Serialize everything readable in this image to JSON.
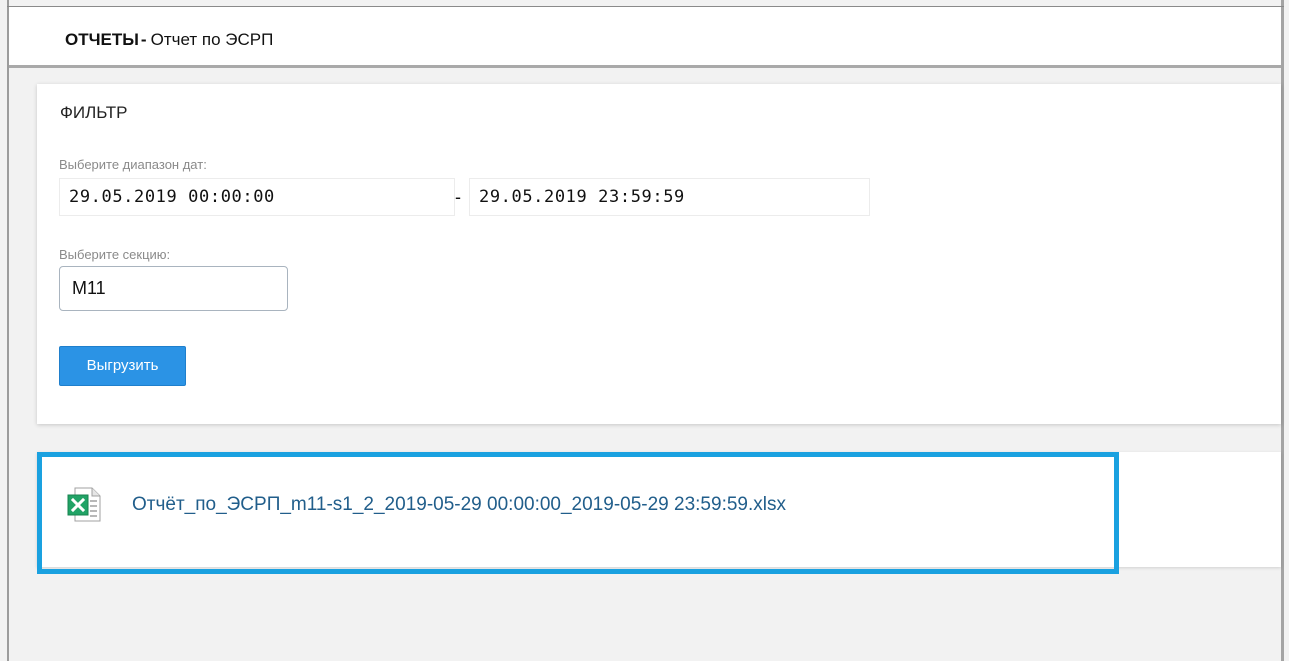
{
  "header": {
    "section": "ОТЧЕТЫ",
    "separator": "-",
    "page": "Отчет по ЭСРП"
  },
  "filter": {
    "title": "ФИЛЬТР",
    "date_range_label": "Выберите диапазон дат:",
    "date_from": "29.05.2019 00:00:00",
    "date_separator": "-",
    "date_to": "29.05.2019 23:59:59",
    "section_label": "Выберите секцию:",
    "section_value": "M11",
    "export_label": "Выгрузить"
  },
  "result": {
    "file_icon": "excel-file-icon",
    "file_name": "Отчёт_по_ЭСРП_m11-s1_2_2019-05-29 00:00:00_2019-05-29 23:59:59.xlsx"
  },
  "colors": {
    "accent": "#2b93e5",
    "highlight": "#1aa1e0",
    "link": "#215e8b",
    "excel_green": "#21a366"
  }
}
